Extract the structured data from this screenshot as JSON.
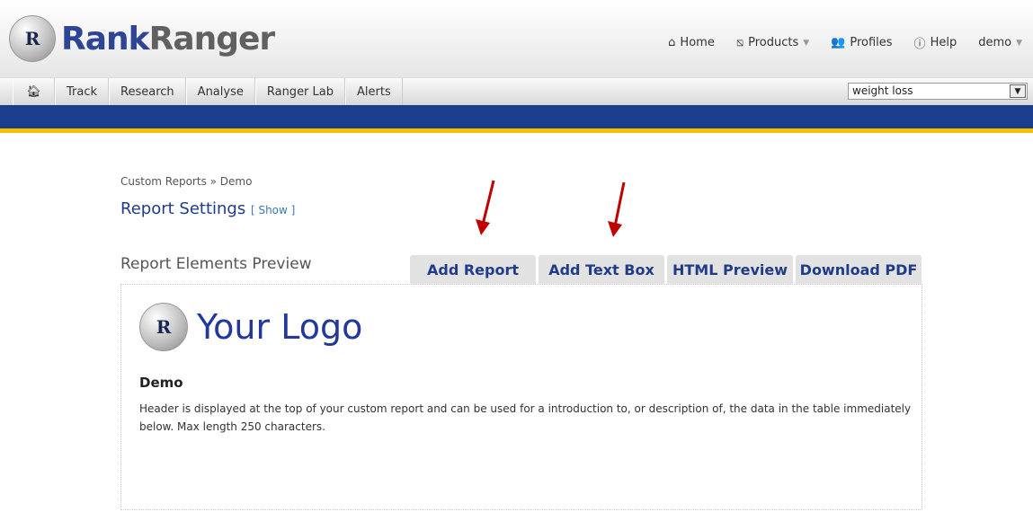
{
  "brand": {
    "part1": "Rank",
    "part2": "Ranger",
    "badge": "R"
  },
  "topnav": [
    {
      "label": "Home",
      "icon": "home-icon"
    },
    {
      "label": "Products",
      "icon": "products-icon"
    },
    {
      "label": "Profiles",
      "icon": "profiles-icon"
    },
    {
      "label": "Help",
      "icon": "help-icon"
    },
    {
      "label": "demo"
    }
  ],
  "tabs": [
    "Track",
    "Research",
    "Analyse",
    "Ranger Lab",
    "Alerts"
  ],
  "profile_select": {
    "value": "weight loss"
  },
  "breadcrumb": "Custom Reports » Demo",
  "settings": {
    "title": "Report Settings",
    "show": "[ Show ]"
  },
  "preview": {
    "title": "Report Elements Preview",
    "buttons": [
      "Add Report",
      "Add Text Box",
      "HTML Preview",
      "Download PDF"
    ],
    "logo_text": "Your Logo",
    "logo_badge": "R",
    "heading": "Demo",
    "description": "Header is displayed at the top of your custom report and can be used for a introduction to, or description of, the data in the table immediately below. Max length 250 characters."
  },
  "colors": {
    "accent": "#1a3d8c",
    "stripe": "#f8be00",
    "arrow": "#c00000"
  }
}
